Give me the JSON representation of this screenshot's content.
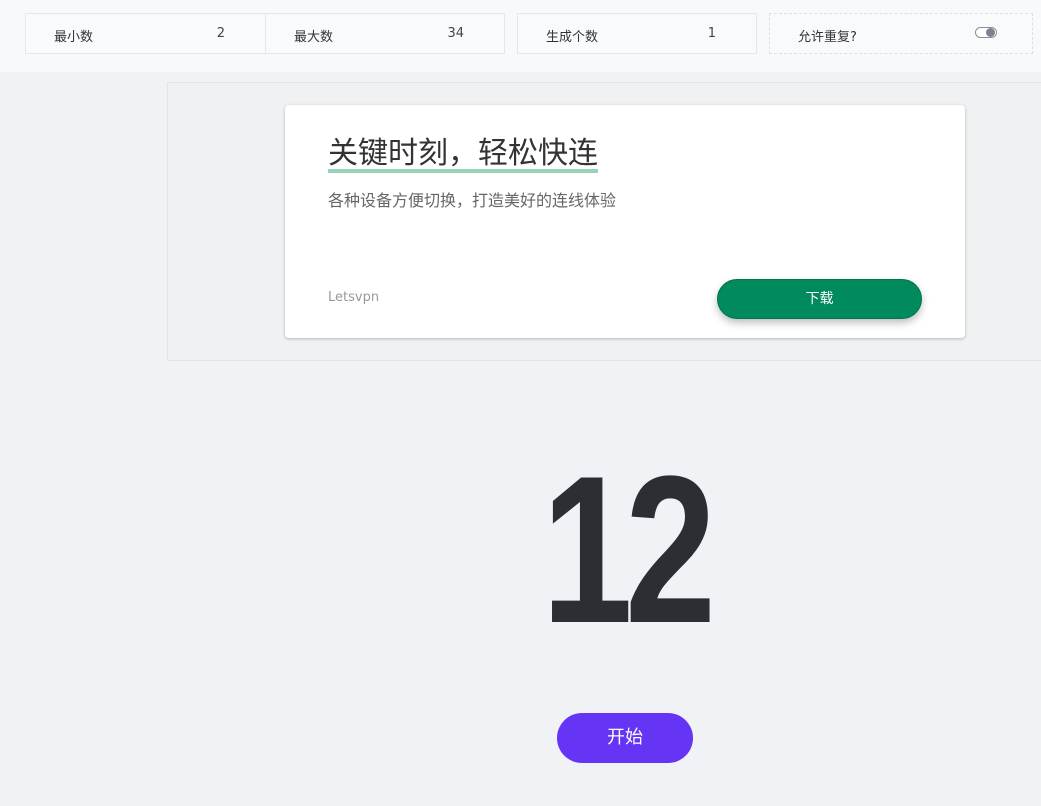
{
  "settings": {
    "min_label": "最小数",
    "min_value": "2",
    "max_label": "最大数",
    "max_value": "34",
    "count_label": "生成个数",
    "count_value": "1",
    "allow_repeat_label": "允许重复?",
    "allow_repeat_on": true
  },
  "ad": {
    "title": "关键时刻，轻松快连",
    "subtitle": "各种设备方便切换，打造美好的连线体验",
    "brand": "Letsvpn",
    "button_label": "下载",
    "accent_color": "#008a5e",
    "underline_color": "#8ccfae"
  },
  "result": {
    "number": "12"
  },
  "start_button": {
    "label": "开始",
    "color": "#6534f5"
  }
}
